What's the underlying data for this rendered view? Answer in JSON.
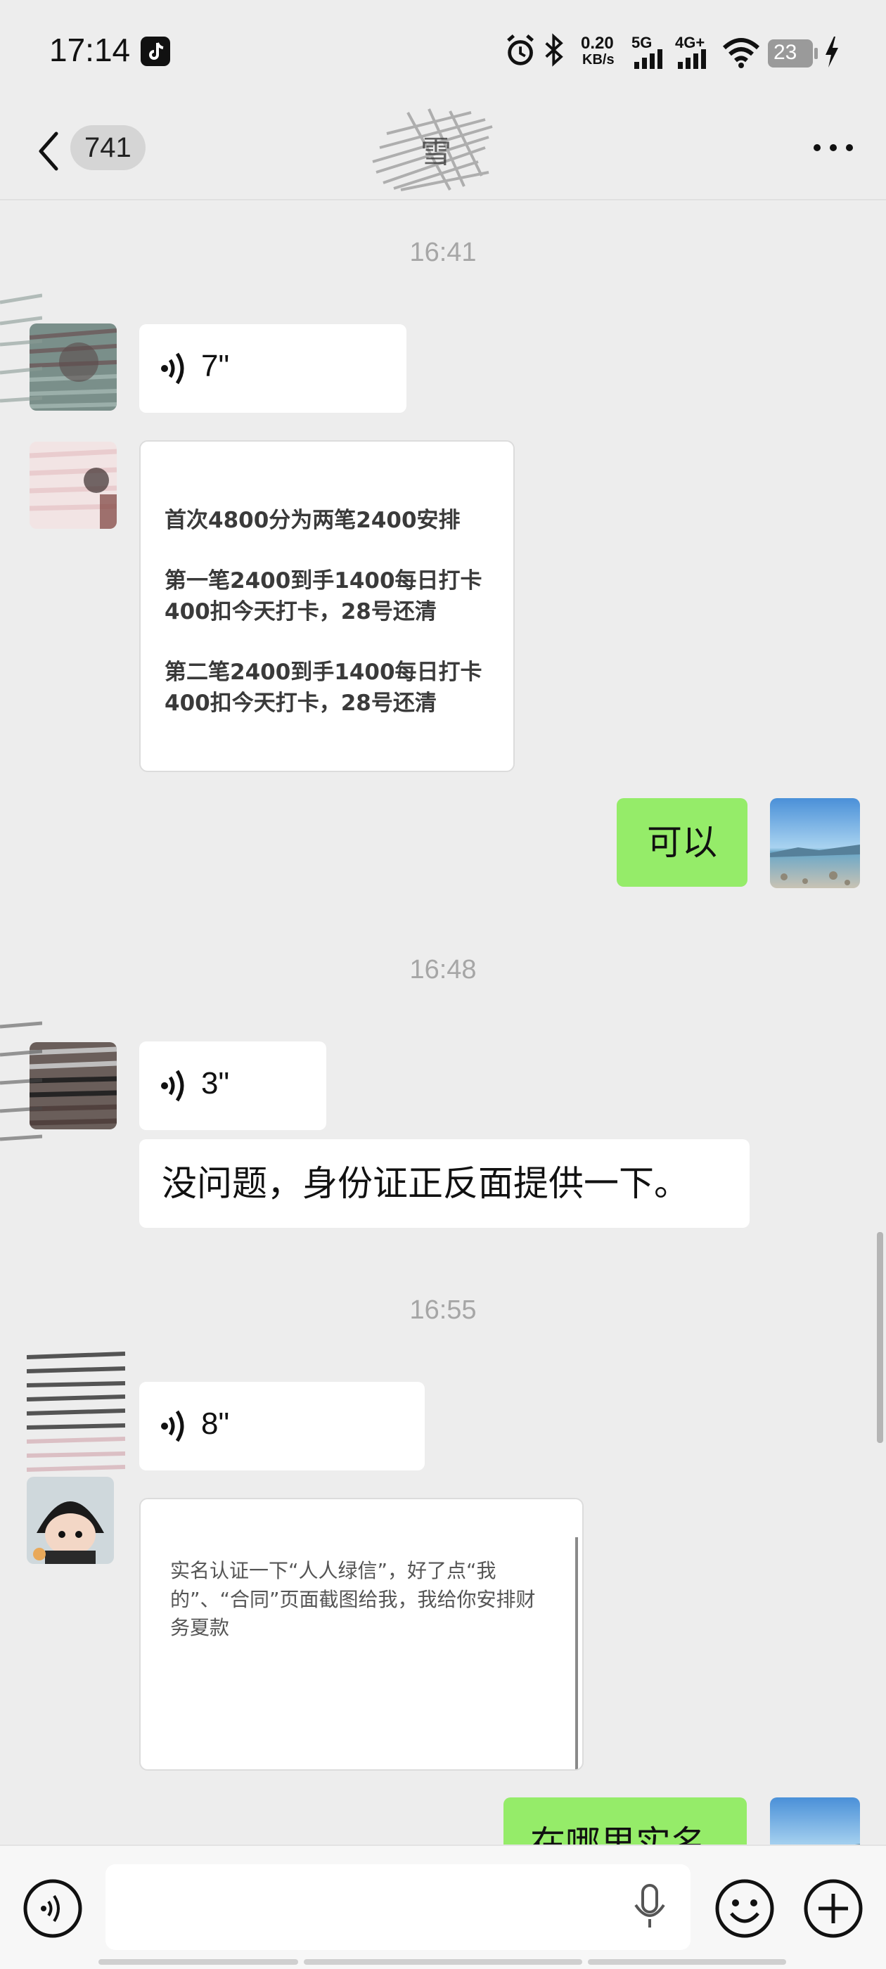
{
  "status_bar": {
    "time": "17:14",
    "net_speed_value": "0.20",
    "net_speed_unit": "KB/s",
    "signal1_label": "5G",
    "signal2_label": "4G+",
    "battery": "23"
  },
  "header": {
    "unread_count": "741",
    "title": "雪"
  },
  "messages": [
    {
      "timestamp": "16:41"
    },
    {
      "voice_duration": "7\""
    },
    {
      "card_lines": [
        "首次4800分为两笔2400安排",
        "第一笔2400到手1400每日打卡\n400扣今天打卡，28号还清",
        "第二笔2400到手1400每日打卡\n400扣今天打卡，28号还清"
      ]
    },
    {
      "mine_text": "可以"
    },
    {
      "timestamp": "16:48"
    },
    {
      "voice_duration": "3\""
    },
    {
      "text": "没问题，身份证正反面提供一下。"
    },
    {
      "timestamp": "16:55"
    },
    {
      "voice_duration": "8\""
    },
    {
      "card_text": "实名认证一下“人人绿信”，好了点“我\n的”、“合同”页面截图给我，我给你安排财\n务夏款"
    },
    {
      "mine_text": "在哪里实名"
    }
  ],
  "colors": {
    "background": "#ededed",
    "mine_bubble": "#95ec69",
    "their_bubble": "#ffffff",
    "timestamp": "#a6a6a6"
  },
  "icons": [
    "back-icon",
    "more-icon",
    "voice-icon",
    "microphone-icon",
    "emoji-icon",
    "plus-icon",
    "alarm-icon",
    "bluetooth-icon",
    "wifi-icon",
    "battery-icon",
    "charging-icon"
  ]
}
